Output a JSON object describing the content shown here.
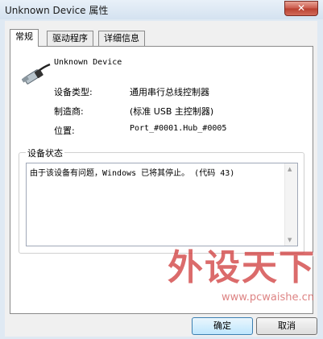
{
  "window": {
    "title": "Unknown Device 属性",
    "close_label": "✕"
  },
  "tabs": [
    {
      "label": "常规",
      "active": true
    },
    {
      "label": "驱动程序",
      "active": false
    },
    {
      "label": "详细信息",
      "active": false
    }
  ],
  "device": {
    "icon": "usb-plug-icon",
    "name": "Unknown Device"
  },
  "properties": [
    {
      "label": "设备类型:",
      "value": "通用串行总线控制器"
    },
    {
      "label": "制造商:",
      "value": "(标准 USB 主控制器)"
    },
    {
      "label": "位置:",
      "value": "Port_#0001.Hub_#0005"
    }
  ],
  "status": {
    "group_label": "设备状态",
    "text": "由于该设备有问题，Windows 已将其停止。 (代码 43)"
  },
  "watermark": {
    "text": "外设天下",
    "url": "www.pcwaishe.cn"
  },
  "buttons": {
    "ok": "确定",
    "cancel": "取消"
  },
  "colors": {
    "close_button": "#c9584a",
    "watermark": "#cf3a3a"
  }
}
